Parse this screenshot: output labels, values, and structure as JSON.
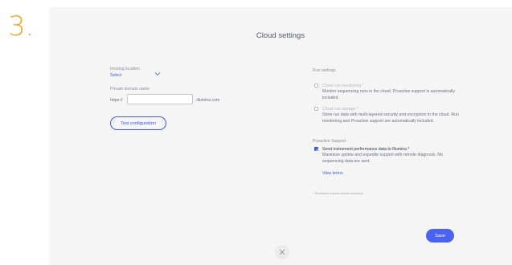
{
  "step": {
    "number": "3."
  },
  "dialog": {
    "title": "Cloud settings",
    "close_icon": "close-icon"
  },
  "hosting": {
    "label": "Hosting location",
    "select_value": "Select",
    "dropdown_icon": "chevron-down-icon"
  },
  "domain": {
    "label": "Private domain name",
    "prefix": "https://",
    "value": "",
    "placeholder": "",
    "suffix": ".illumina.com"
  },
  "test_configuration": {
    "label": "Test configuration"
  },
  "run_settings": {
    "label": "Run settings",
    "options": [
      {
        "title": "Cloud run monitoring *",
        "description": "Monitor sequencing runs in the cloud.  Proactive support is automatically included.",
        "checked": false,
        "disabled": true
      },
      {
        "title": "Cloud run storage *",
        "description": "Store run data with multi-layered security and encryption in the cloud.  Run monitoring and Proactive support are automatically included.",
        "checked": false,
        "disabled": true
      }
    ]
  },
  "proactive_support": {
    "label": "Proactive Support",
    "option": {
      "title": "Send instrument performance data to Illumina *",
      "description": "Maximize uptime and expedite support with remote diagnosis. No sequencing data are sent.",
      "checked": true,
      "disabled": false
    },
    "view_terms": "View terms"
  },
  "footnote": "* This feature requires internet connection",
  "save": {
    "label": "Save"
  },
  "colors": {
    "accent": "#3b5bdb",
    "save_button": "#4a63f0",
    "step_number": "#f5a623",
    "panel_background": "#f5f5f6"
  }
}
